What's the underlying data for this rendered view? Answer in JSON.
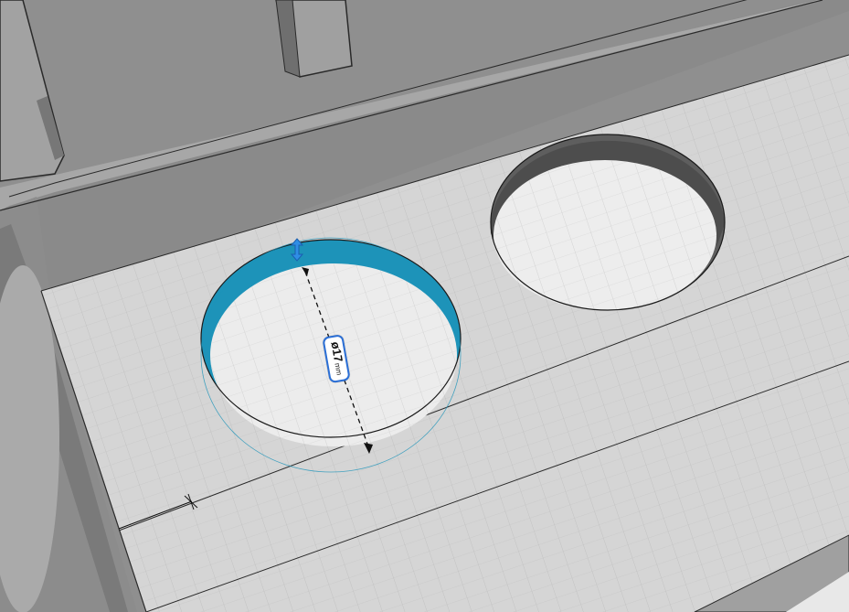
{
  "dimension": {
    "value": "ø17",
    "unit": "mm"
  },
  "colors": {
    "selected_hole_wall": "#1d93b9",
    "handle": "#2f8ee5",
    "label_border": "#2b6fd6",
    "workplane": "#d6d6d6",
    "grid_line": "#bdbdbd",
    "hole_floor": "#ededed"
  },
  "icons": {
    "resize_handle": "vertical-double-arrow-icon",
    "workplane_origin": "origin-cross-icon"
  }
}
